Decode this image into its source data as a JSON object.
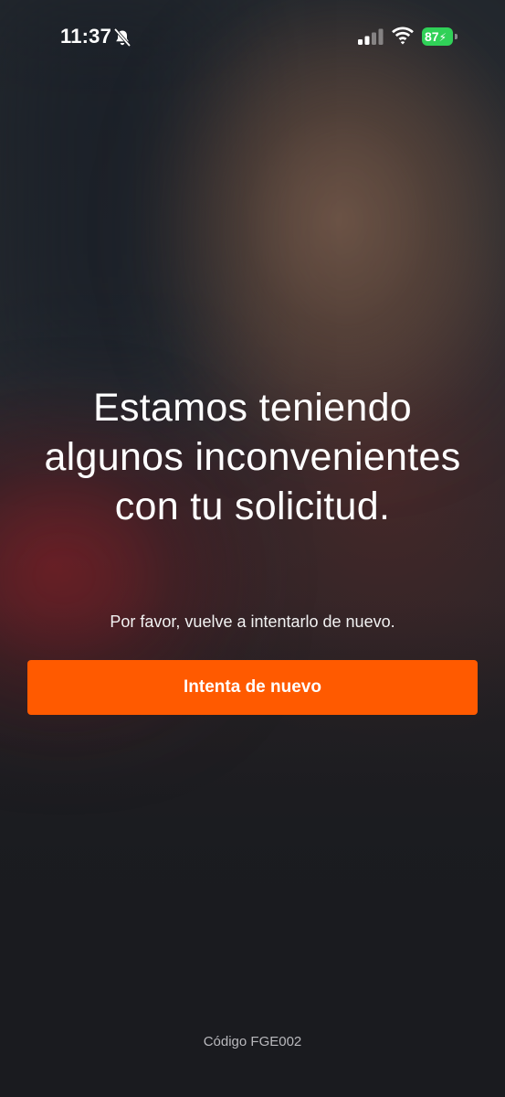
{
  "status_bar": {
    "time": "11:37",
    "battery_level": "87",
    "icons": [
      "bell-slash-icon",
      "signal-icon",
      "wifi-icon",
      "battery-charging-icon"
    ],
    "battery_color": "#30d158"
  },
  "error": {
    "headline": "Estamos teniendo algunos inconvenientes con tu solicitud.",
    "message": "Por favor, vuelve a intentarlo de nuevo.",
    "retry_label": "Intenta de nuevo",
    "code": "Código FGE002"
  },
  "colors": {
    "accent": "#ff5a00",
    "background": "#1a1b1f",
    "text": "#ffffff"
  }
}
